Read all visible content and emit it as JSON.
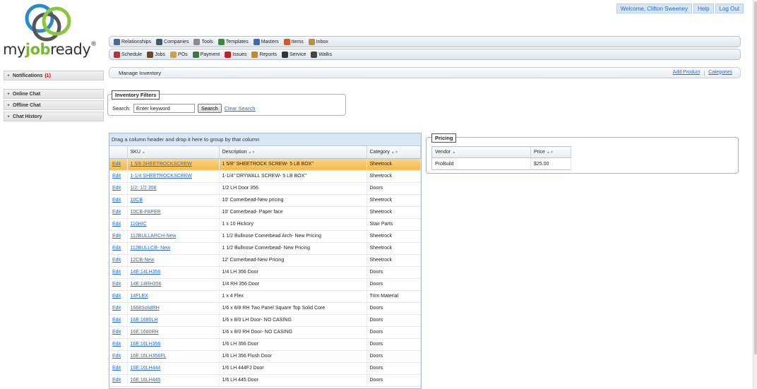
{
  "brand": {
    "logo_pre": "my",
    "logo_bold": "job",
    "logo_post": "ready",
    "reg": "®"
  },
  "top_links": [
    "Welcome, Clifton Sweeney",
    "Help",
    "Log Out"
  ],
  "nav_row1": [
    {
      "label": "Relationships",
      "icon": "people-icon",
      "color": "#4a6a9a"
    },
    {
      "label": "Companies",
      "icon": "buildings-icon",
      "color": "#3b5b7e"
    },
    {
      "label": "Tools",
      "icon": "tools-icon",
      "color": "#8a8a8a"
    },
    {
      "label": "Templates",
      "icon": "templates-icon",
      "color": "#3a8a3a"
    },
    {
      "label": "Masters",
      "icon": "masters-icon",
      "color": "#3a6ac0"
    },
    {
      "label": "Items",
      "icon": "items-icon",
      "color": "#d05a20"
    },
    {
      "label": "Inbox",
      "icon": "inbox-icon",
      "color": "#b89040"
    }
  ],
  "nav_row2": [
    {
      "label": "Schedule",
      "icon": "calendar-icon",
      "color": "#c03030"
    },
    {
      "label": "Jobs",
      "icon": "briefcase-icon",
      "color": "#6a4a2a"
    },
    {
      "label": "POs",
      "icon": "folder-icon",
      "color": "#d0a040"
    },
    {
      "label": "Payment",
      "icon": "payment-icon",
      "color": "#3a7a3a"
    },
    {
      "label": "Issues",
      "icon": "pin-icon",
      "color": "#c02020"
    },
    {
      "label": "Reports",
      "icon": "reports-icon",
      "color": "#c08a30"
    },
    {
      "label": "Service",
      "icon": "wrench-icon",
      "color": "#333333"
    },
    {
      "label": "Walks",
      "icon": "clipboard-icon",
      "color": "#444444"
    }
  ],
  "sidebar": [
    {
      "label": "Notifications",
      "count": "(1)"
    },
    {
      "label": "Online Chat",
      "count": ""
    },
    {
      "label": "Offline Chat",
      "count": ""
    },
    {
      "label": "Chat History",
      "count": ""
    }
  ],
  "manage": {
    "title": "Manage Inventory",
    "add_product": "Add Product",
    "sep": "|",
    "categories": "Categories"
  },
  "filters": {
    "legend": "Inventory Filters",
    "search_label": "Search:",
    "search_value": "Enter keyword",
    "search_button": "Search",
    "clear": "Clear Search"
  },
  "grid": {
    "group_hint": "Drag a column header and drop it here to group by that column",
    "headers": [
      "SKU",
      "Description",
      "Category"
    ],
    "edit_label": "Edit",
    "rows": [
      [
        "1 5/8 SHEETROCKSCREW",
        "1 5/8\" SHEETROCK SCREW- 5 LB BOX\"",
        "Sheetrock"
      ],
      [
        "1-1/4 SHEETROCKSCREW",
        "1-1/4\" DRYWALL SCREW- 5 LB BOX\"",
        "Sheetrock"
      ],
      [
        "1/2: 1/2 356",
        "1/2 LH Door 356",
        "Doors"
      ],
      [
        "10CB",
        "10' Cornerbead-New pricing",
        "Sheetrock"
      ],
      [
        "10CB-PAPER",
        "10' Cornerbead- Paper face",
        "Sheetrock"
      ],
      [
        "110HIC",
        "1 x 10 Hickory",
        "Stair Parts"
      ],
      [
        "112BULLARCH-New",
        "1 1/2 Bullnose Comerbead Arch- New Pricing",
        "Sheetrock"
      ],
      [
        "112BULLCB- New",
        "1 1/2 Bullnose Comerbead- New Pricing",
        "Sheetrock"
      ],
      [
        "12CB-New",
        "12' Cornerbead-New Pricing",
        "Sheetrock"
      ],
      [
        "14E:14LH356",
        "1/4 LH 356 Door",
        "Doors"
      ],
      [
        "14E:14RH356",
        "1/4 RH 356 Door",
        "Doors"
      ],
      [
        "14FLEX",
        "1 x 4 Flex",
        "Trim Material"
      ],
      [
        "1668SolidRH",
        "1/6 x 6/8 RH Two Panel Square Top Solid Core",
        "Doors"
      ],
      [
        "16E:1680LH",
        "1/6 x 8/0 LH Door- NO CASING",
        "Doors"
      ],
      [
        "16E:1680RH",
        "1/6 x 8/0 RH Door- NO CASING",
        "Doors"
      ],
      [
        "16E:16LH356",
        "1/6 LH 356 Door",
        "Doors"
      ],
      [
        "16E:16LH356FL",
        "1/6 LH 356 Flush Door",
        "Doors"
      ],
      [
        "16E:16LH444",
        "1/6 LH 444FJ Door",
        "Doors"
      ],
      [
        "16E:16LH445",
        "1/6 LH 445 Door",
        "Doors"
      ]
    ]
  },
  "pricing": {
    "legend": "Pricing",
    "headers": [
      "Vendor",
      "Price"
    ],
    "rows": [
      [
        "ProBuild",
        "$25.00"
      ]
    ]
  }
}
